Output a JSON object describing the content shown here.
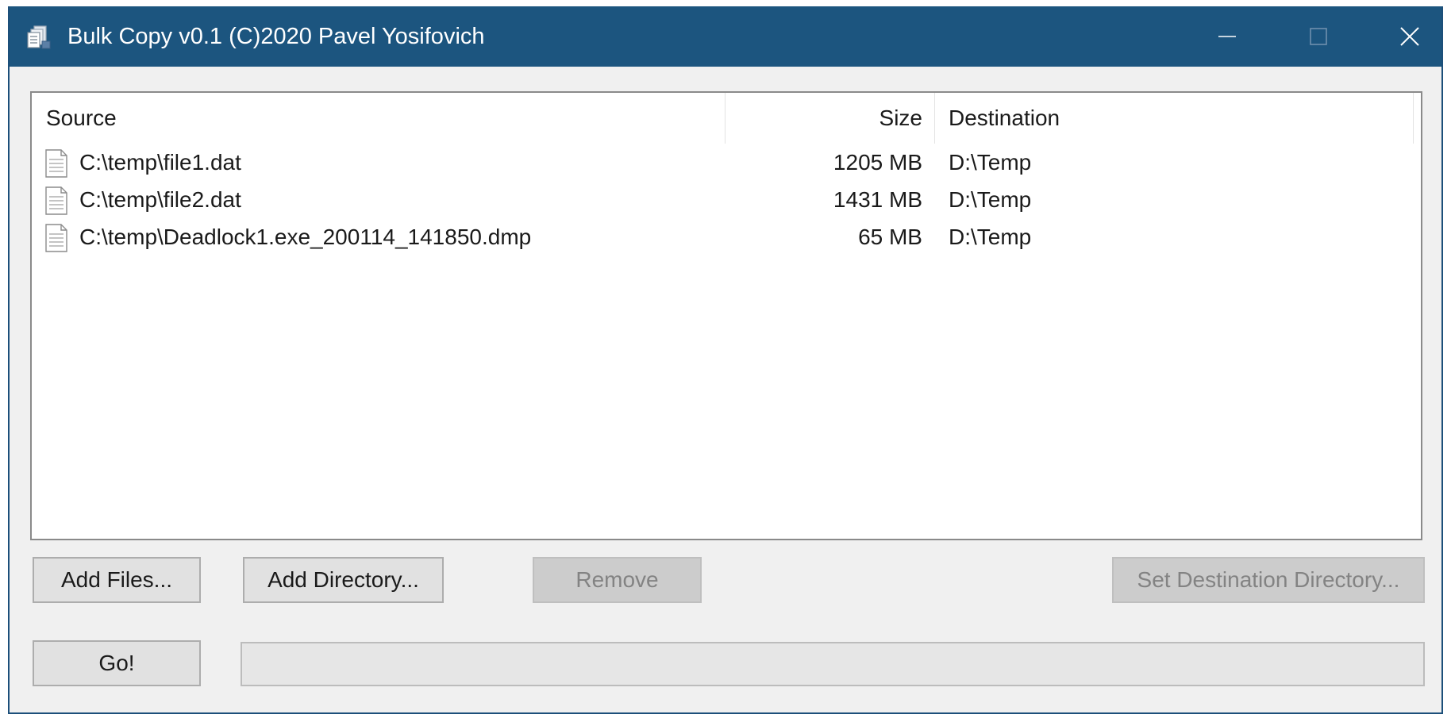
{
  "window": {
    "title": "Bulk Copy v0.1 (C)2020 Pavel Yosifovich",
    "titlebar_color": "#1c557f",
    "app_icon": "copy-files-icon",
    "caption_icons": [
      "minimize-icon",
      "maximize-icon",
      "close-icon"
    ]
  },
  "list": {
    "columns": {
      "source": "Source",
      "size": "Size",
      "destination": "Destination"
    },
    "rows": [
      {
        "source": "C:\\temp\\file1.dat",
        "size": "1205 MB",
        "destination": "D:\\Temp",
        "icon": "file-icon"
      },
      {
        "source": "C:\\temp\\file2.dat",
        "size": "1431 MB",
        "destination": "D:\\Temp",
        "icon": "file-icon"
      },
      {
        "source": "C:\\temp\\Deadlock1.exe_200114_141850.dmp",
        "size": "65 MB",
        "destination": "D:\\Temp",
        "icon": "file-icon"
      }
    ]
  },
  "buttons": {
    "add_files": "Add Files...",
    "add_directory": "Add Directory...",
    "remove": "Remove",
    "set_destination": "Set Destination Directory...",
    "go": "Go!"
  },
  "progress": {
    "fraction": 0
  }
}
